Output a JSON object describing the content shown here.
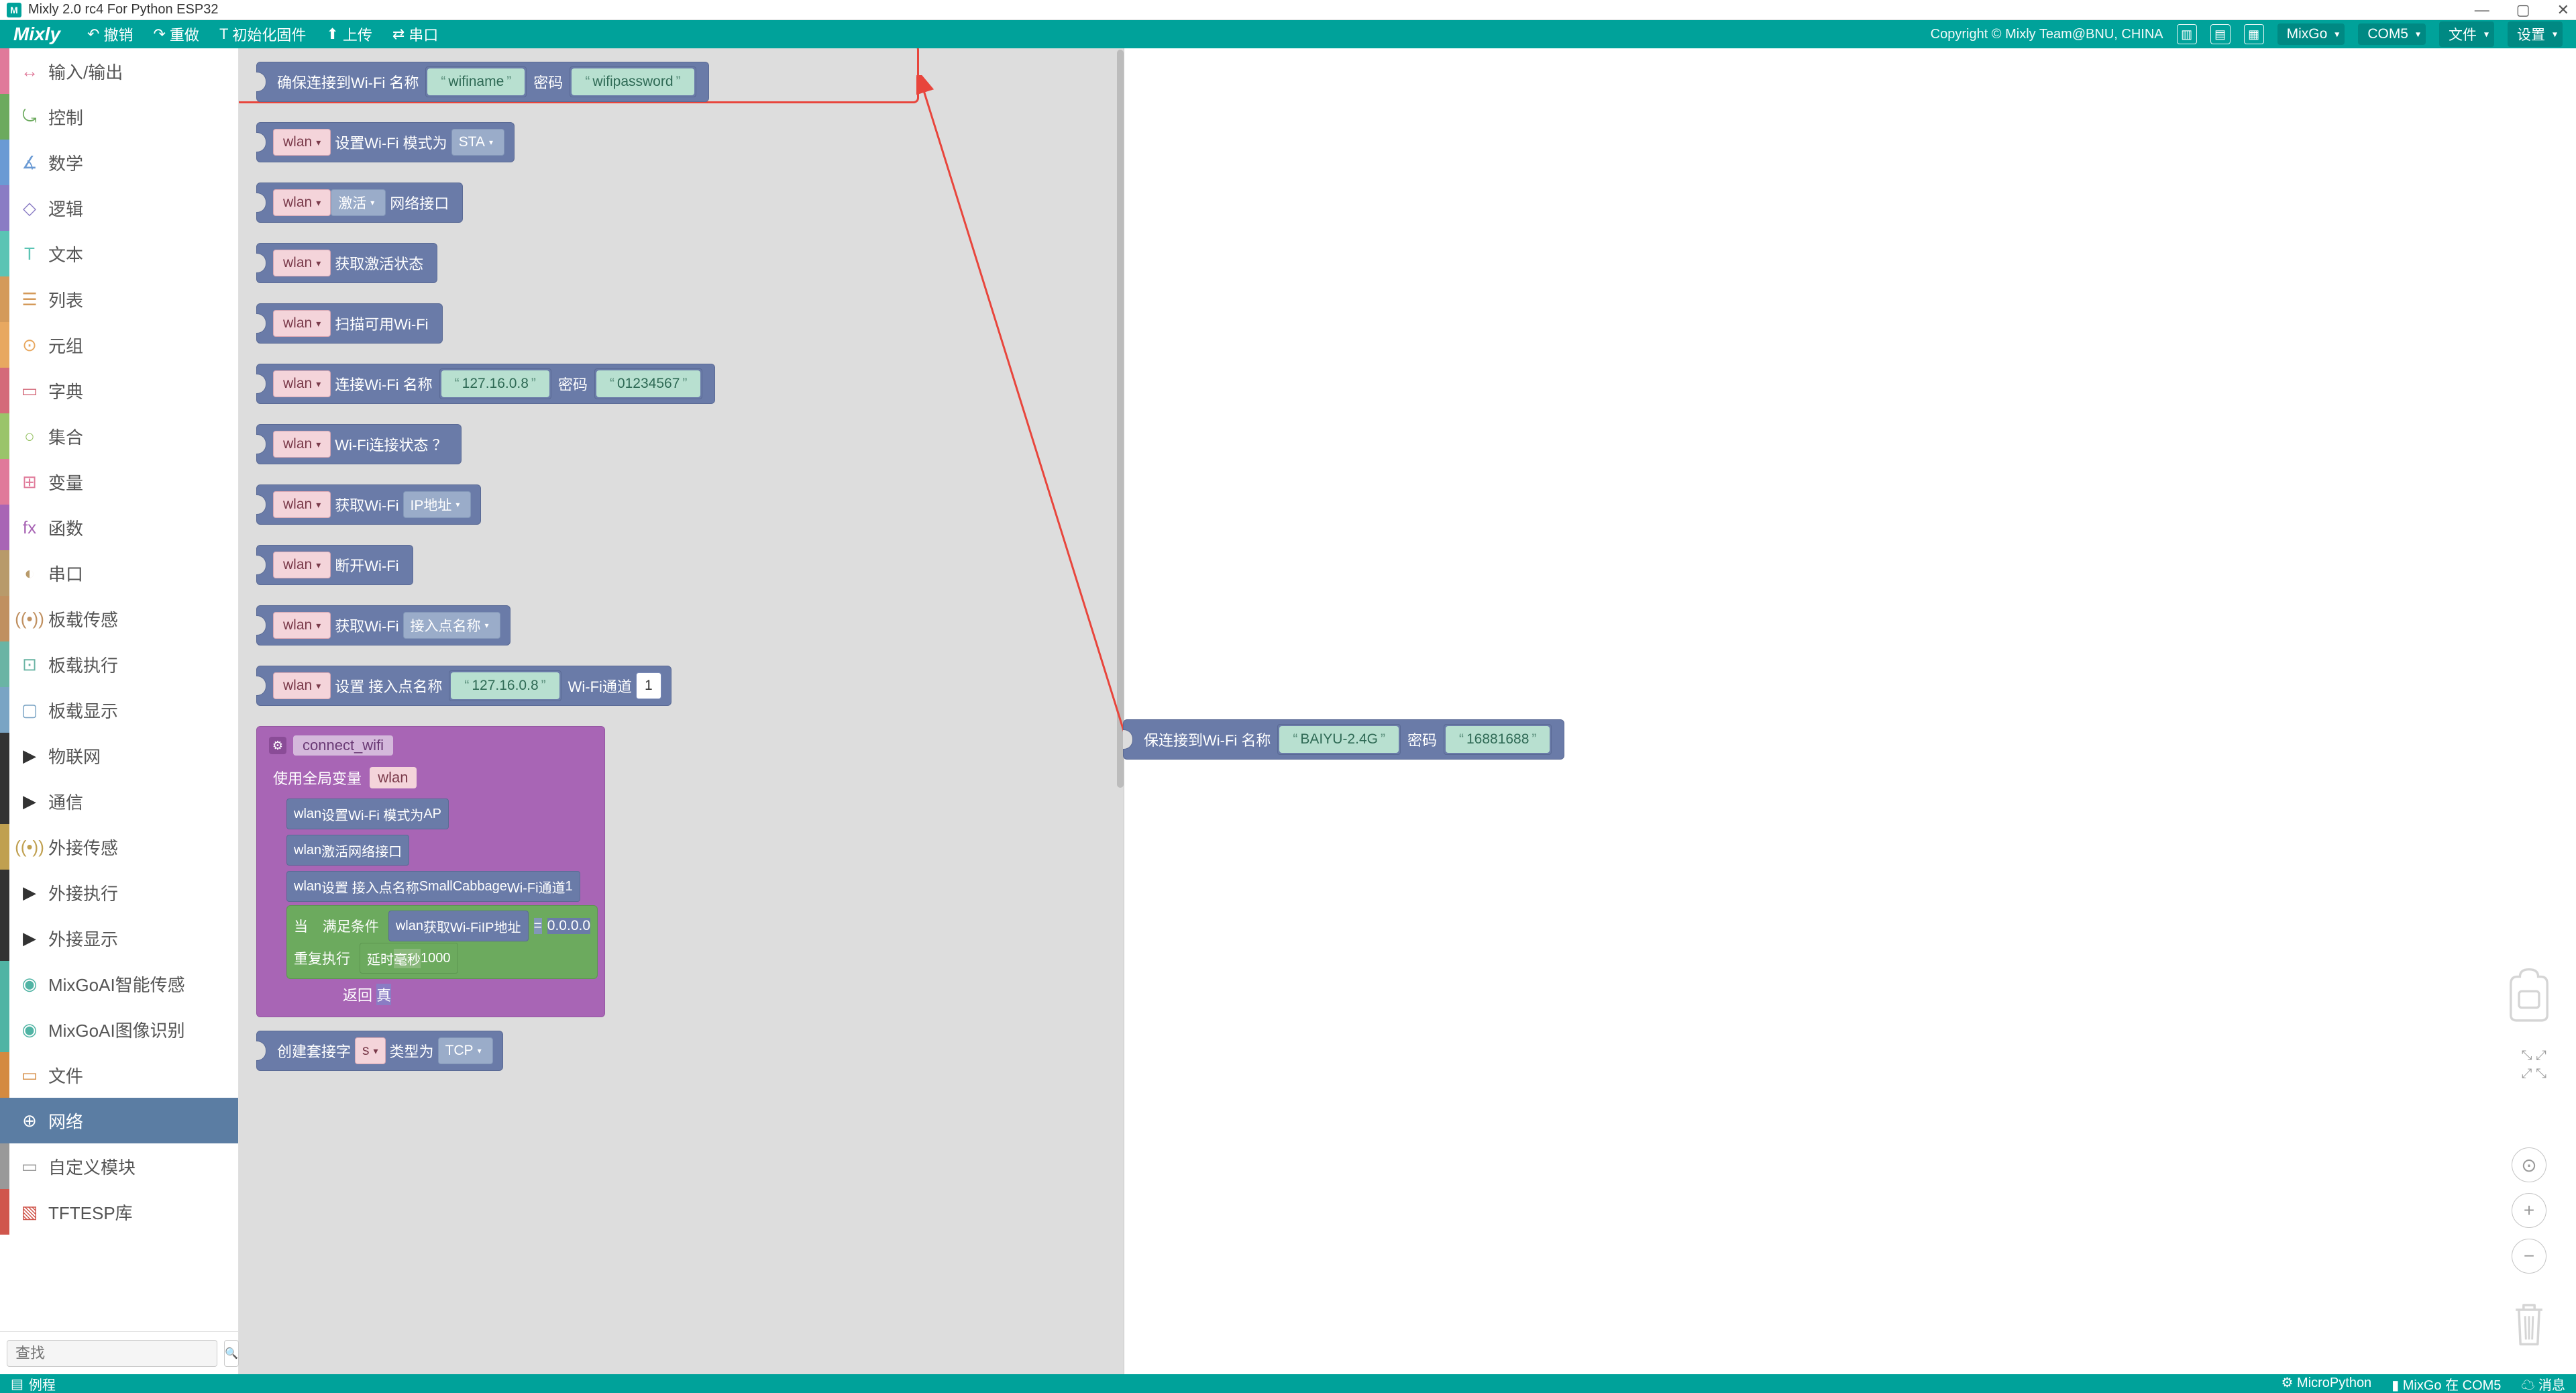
{
  "title": "Mixly 2.0 rc4 For Python ESP32",
  "menubar": {
    "logo": "Mixly",
    "undo": "撤销",
    "redo": "重做",
    "init": "初始化固件",
    "upload": "上传",
    "serial": "串口",
    "copyright": "Copyright © Mixly Team@BNU, CHINA",
    "board": "MixGo",
    "port": "COM5",
    "file": "文件",
    "settings": "设置"
  },
  "sidebar": [
    {
      "label": "输入/输出",
      "color": "#e07a9a",
      "icon": "↔"
    },
    {
      "label": "控制",
      "color": "#6caa5e",
      "icon": "⤿"
    },
    {
      "label": "数学",
      "color": "#6a9ad4",
      "icon": "∡"
    },
    {
      "label": "逻辑",
      "color": "#8a7cc4",
      "icon": "◇"
    },
    {
      "label": "文本",
      "color": "#5bc4b4",
      "icon": "T"
    },
    {
      "label": "列表",
      "color": "#d49a5a",
      "icon": "☰"
    },
    {
      "label": "元组",
      "color": "#e8a860",
      "icon": "⊙"
    },
    {
      "label": "字典",
      "color": "#d46a7a",
      "icon": "▭"
    },
    {
      "label": "集合",
      "color": "#9ac46a",
      "icon": "○"
    },
    {
      "label": "变量",
      "color": "#e07a9a",
      "icon": "⊞"
    },
    {
      "label": "函数",
      "color": "#a865b5",
      "icon": "fx"
    },
    {
      "label": "串口",
      "color": "#b89a6a",
      "icon": "◐"
    },
    {
      "label": "板载传感",
      "color": "#c09060",
      "icon": "((•))"
    },
    {
      "label": "板载执行",
      "color": "#6ab4a4",
      "icon": "⊡"
    },
    {
      "label": "板载显示",
      "color": "#7aa4c4",
      "icon": "▢"
    },
    {
      "label": "物联网",
      "color": "#333",
      "icon": "▶"
    },
    {
      "label": "通信",
      "color": "#333",
      "icon": "▶"
    },
    {
      "label": "外接传感",
      "color": "#c0a050",
      "icon": "((•))"
    },
    {
      "label": "外接执行",
      "color": "#333",
      "icon": "▶"
    },
    {
      "label": "外接显示",
      "color": "#333",
      "icon": "▶"
    },
    {
      "label": "MixGoAI智能传感",
      "color": "#50b4a4",
      "icon": "◉"
    },
    {
      "label": "MixGoAI图像识别",
      "color": "#50b4a4",
      "icon": "◉"
    },
    {
      "label": "文件",
      "color": "#d48a40",
      "icon": "▭"
    },
    {
      "label": "网络",
      "color": "#5b7da3",
      "icon": "⊕",
      "active": true
    },
    {
      "label": "自定义模块",
      "color": "#999",
      "icon": "▭"
    },
    {
      "label": "TFTESP库",
      "color": "#d0564c",
      "icon": "▧"
    }
  ],
  "search": {
    "placeholder": "查找"
  },
  "blocks": {
    "b1": {
      "t1": "确保连接到Wi-Fi  名称",
      "s1": "wifiname",
      "t2": "密码",
      "s2": "wifipassword"
    },
    "b2": {
      "v": "wlan",
      "t": "设置Wi-Fi  模式为",
      "d": "STA"
    },
    "b3": {
      "v": "wlan",
      "d": "激活",
      "t": "网络接口"
    },
    "b4": {
      "v": "wlan",
      "t": "获取激活状态"
    },
    "b5": {
      "v": "wlan",
      "t": "扫描可用Wi-Fi"
    },
    "b6": {
      "v": "wlan",
      "t1": "连接Wi-Fi  名称",
      "s1": "127.16.0.8",
      "t2": "密码",
      "s2": "01234567"
    },
    "b7": {
      "v": "wlan",
      "t": "Wi-Fi连接状态 ？"
    },
    "b8": {
      "v": "wlan",
      "t": "获取Wi-Fi",
      "d": "IP地址"
    },
    "b9": {
      "v": "wlan",
      "t": "断开Wi-Fi"
    },
    "b10": {
      "v": "wlan",
      "t": "获取Wi-Fi",
      "d": "接入点名称"
    },
    "b11": {
      "v": "wlan",
      "t1": "设置  接入点名称",
      "s1": "127.16.0.8",
      "t2": "Wi-Fi通道",
      "n": "1"
    },
    "func": {
      "name": "connect_wifi",
      "globals": "使用全局变量",
      "gv": "wlan",
      "r1": {
        "v": "wlan",
        "t": "设置Wi-Fi  模式为",
        "d": "AP"
      },
      "r2": {
        "v": "wlan",
        "d": "激活",
        "t": "网络接口"
      },
      "r3": {
        "v": "wlan",
        "t1": "设置  接入点名称",
        "s1": "SmallCabbage",
        "t2": "Wi-Fi通道",
        "n": "1"
      },
      "cond": {
        "t1": "当",
        "t2": "满足条件",
        "v": "wlan",
        "gt": "获取Wi-Fi",
        "gd": "IP地址",
        "eq": "=",
        "cmp": "0.0.0.0",
        "loop": "重复执行",
        "delay": "延时",
        "unit": "毫秒",
        "ms": "1000",
        "ret": "返回",
        "rv": "真"
      }
    },
    "b12": {
      "t1": "创建套接字",
      "v": "s",
      "t2": "类型为",
      "d": "TCP"
    },
    "canvas": {
      "t1": "保连接到Wi-Fi  名称",
      "s1": "BAIYU-2.4G",
      "t2": "密码",
      "s2": "16881688"
    }
  },
  "statusbar": {
    "left": "例程",
    "mp": "MicroPython",
    "mid": "MixGo 在 COM5",
    "msg": "消息"
  }
}
